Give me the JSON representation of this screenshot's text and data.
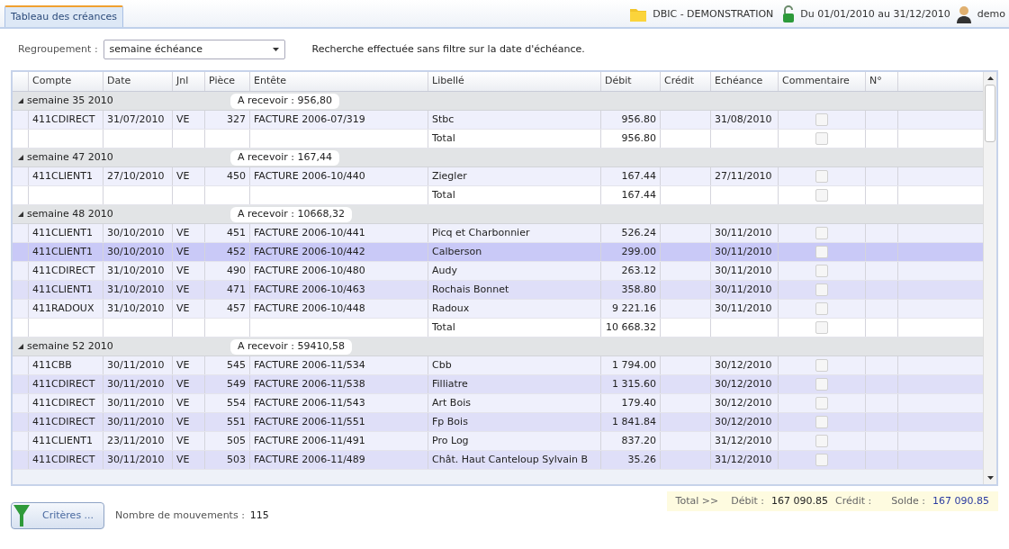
{
  "tab": {
    "label": "Tableau des créances",
    "selected": true
  },
  "header": {
    "company": "DBIC - DEMONSTRATION",
    "period": "Du 01/01/2010 au 31/12/2010",
    "user": "demo"
  },
  "toolbar": {
    "grouping_label": "Regroupement :",
    "grouping_value": "semaine échéance",
    "info": "Recherche effectuée sans filtre sur la date d'échéance."
  },
  "columns": [
    "Compte",
    "Date",
    "Jnl",
    "Pièce",
    "Entête",
    "Libellé",
    "Débit",
    "Crédit",
    "Echéance",
    "Commentaire",
    "N°"
  ],
  "groups": [
    {
      "label": "semaine 35 2010",
      "summary": "A recevoir : 956,80",
      "expanded": true,
      "rows": [
        {
          "kind": "data",
          "compte": "411CDIRECT",
          "date": "31/07/2010",
          "jnl": "VE",
          "piece": "327",
          "entete": "FACTURE 2006-07/319",
          "libelle": "Stbc",
          "debit": "956.80",
          "echeance": "31/08/2010",
          "checked": false,
          "selected": false
        },
        {
          "kind": "total",
          "libelle": "Total",
          "debit": "956.80",
          "checked": false,
          "selected": false
        }
      ]
    },
    {
      "label": "semaine 47 2010",
      "summary": "A recevoir : 167,44",
      "expanded": true,
      "rows": [
        {
          "kind": "data",
          "compte": "411CLIENT1",
          "date": "27/10/2010",
          "jnl": "VE",
          "piece": "450",
          "entete": "FACTURE 2006-10/440",
          "libelle": "Ziegler",
          "debit": "167.44",
          "echeance": "27/11/2010",
          "checked": false,
          "selected": false
        },
        {
          "kind": "total",
          "libelle": "Total",
          "debit": "167.44",
          "checked": false,
          "selected": false
        }
      ]
    },
    {
      "label": "semaine 48 2010",
      "summary": "A recevoir : 10668,32",
      "expanded": true,
      "rows": [
        {
          "kind": "data",
          "compte": "411CLIENT1",
          "date": "30/10/2010",
          "jnl": "VE",
          "piece": "451",
          "entete": "FACTURE 2006-10/441",
          "libelle": "Picq et Charbonnier",
          "debit": "526.24",
          "echeance": "30/11/2010",
          "checked": false,
          "selected": false
        },
        {
          "kind": "data",
          "compte": "411CLIENT1",
          "date": "30/10/2010",
          "jnl": "VE",
          "piece": "452",
          "entete": "FACTURE 2006-10/442",
          "libelle": "Calberson",
          "debit": "299.00",
          "echeance": "30/11/2010",
          "checked": false,
          "selected": true
        },
        {
          "kind": "data",
          "compte": "411CDIRECT",
          "date": "31/10/2010",
          "jnl": "VE",
          "piece": "490",
          "entete": "FACTURE 2006-10/480",
          "libelle": "Audy",
          "debit": "263.12",
          "echeance": "30/11/2010",
          "checked": false,
          "selected": false
        },
        {
          "kind": "data",
          "compte": "411CLIENT1",
          "date": "31/10/2010",
          "jnl": "VE",
          "piece": "471",
          "entete": "FACTURE 2006-10/463",
          "libelle": "Rochais Bonnet",
          "debit": "358.80",
          "echeance": "30/11/2010",
          "checked": false,
          "selected": false
        },
        {
          "kind": "data",
          "compte": "411RADOUX",
          "date": "31/10/2010",
          "jnl": "VE",
          "piece": "457",
          "entete": "FACTURE 2006-10/448",
          "libelle": "Radoux",
          "debit": "9 221.16",
          "echeance": "30/11/2010",
          "checked": false,
          "selected": false
        },
        {
          "kind": "total",
          "libelle": "Total",
          "debit": "10 668.32",
          "checked": false,
          "selected": false
        }
      ]
    },
    {
      "label": "semaine 52 2010",
      "summary": "A recevoir : 59410,58",
      "expanded": true,
      "rows": [
        {
          "kind": "data",
          "compte": "411CBB",
          "date": "30/11/2010",
          "jnl": "VE",
          "piece": "545",
          "entete": "FACTURE 2006-11/534",
          "libelle": "Cbb",
          "debit": "1 794.00",
          "echeance": "30/12/2010",
          "checked": false,
          "selected": false
        },
        {
          "kind": "data",
          "compte": "411CDIRECT",
          "date": "30/11/2010",
          "jnl": "VE",
          "piece": "549",
          "entete": "FACTURE 2006-11/538",
          "libelle": "Filliatre",
          "debit": "1 315.60",
          "echeance": "30/12/2010",
          "checked": false,
          "selected": false
        },
        {
          "kind": "data",
          "compte": "411CDIRECT",
          "date": "30/11/2010",
          "jnl": "VE",
          "piece": "554",
          "entete": "FACTURE 2006-11/543",
          "libelle": "Art Bois",
          "debit": "179.40",
          "echeance": "30/12/2010",
          "checked": false,
          "selected": false
        },
        {
          "kind": "data",
          "compte": "411CDIRECT",
          "date": "30/11/2010",
          "jnl": "VE",
          "piece": "551",
          "entete": "FACTURE 2006-11/551",
          "libelle": "Fp Bois",
          "debit": "1 841.84",
          "echeance": "30/12/2010",
          "checked": false,
          "selected": false
        },
        {
          "kind": "data",
          "compte": "411CLIENT1",
          "date": "23/11/2010",
          "jnl": "VE",
          "piece": "505",
          "entete": "FACTURE 2006-11/491",
          "libelle": "Pro Log",
          "debit": "837.20",
          "echeance": "31/12/2010",
          "checked": false,
          "selected": false
        },
        {
          "kind": "data",
          "compte": "411CDIRECT",
          "date": "30/11/2010",
          "jnl": "VE",
          "piece": "503",
          "entete": "FACTURE 2006-11/489",
          "libelle": "Chât. Haut Canteloup Sylvain B",
          "debit": "35.26",
          "echeance": "31/12/2010",
          "checked": false,
          "selected": false
        }
      ]
    }
  ],
  "footer": {
    "criteria_button": "Critères ...",
    "count_label": "Nombre de mouvements :",
    "count": "115"
  },
  "totals": {
    "label": "Total >>",
    "debit_label": "Débit :",
    "debit": "167 090.85",
    "credit_label": "Crédit :",
    "balance_label": "Solde :",
    "balance": "167 090.85"
  }
}
